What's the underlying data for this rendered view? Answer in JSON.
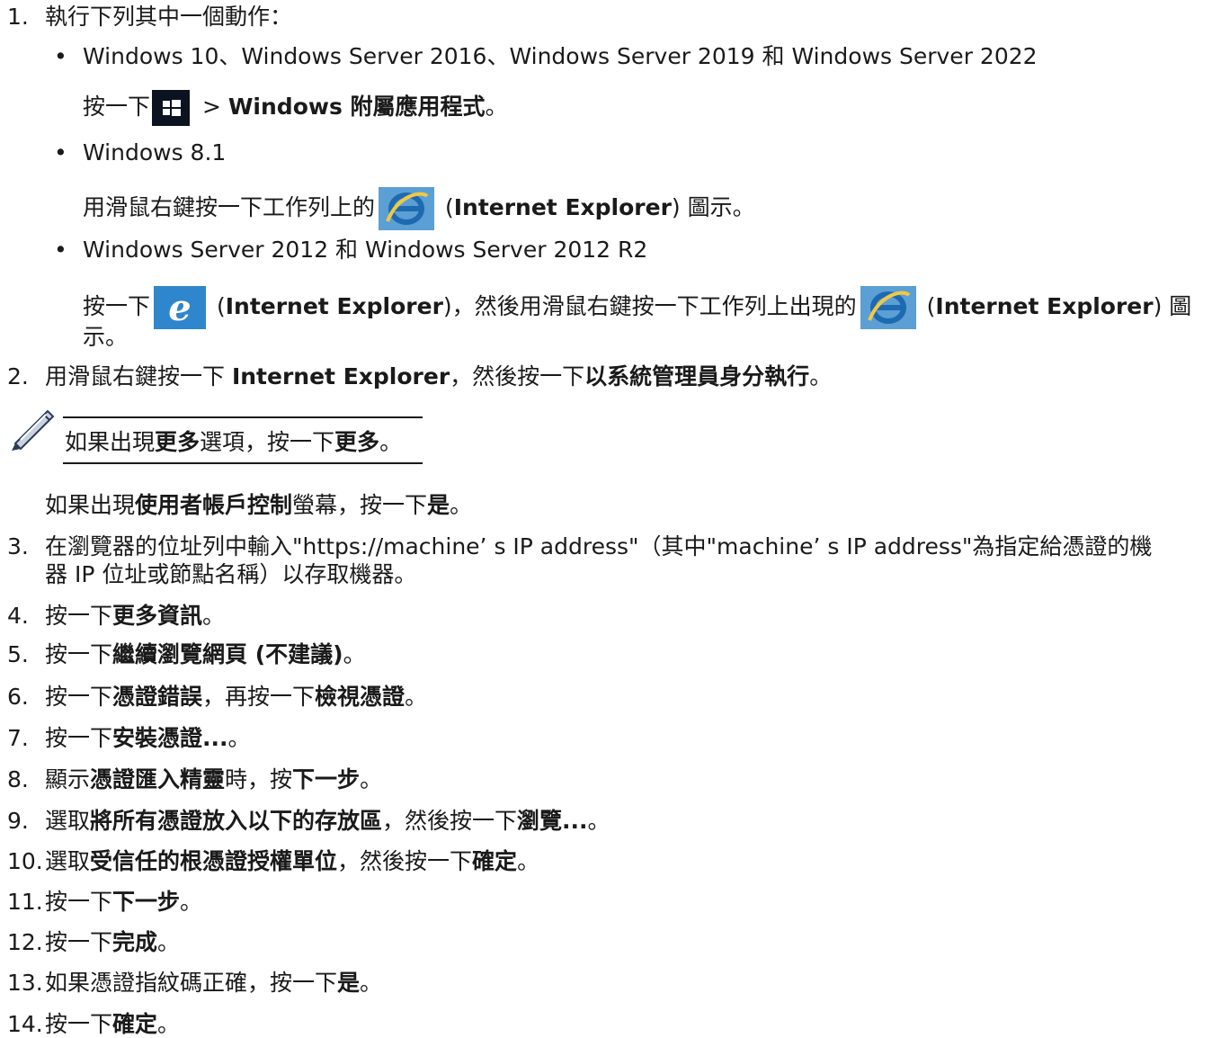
{
  "steps": {
    "s1": {
      "num": "1.",
      "text": "執行下列其中一個動作："
    },
    "s1_b1": {
      "title": "Windows 10、Windows Server 2016、Windows Server 2019 和 Windows Server 2022",
      "pre": "按一下",
      "gt": " > ",
      "bold": "Windows 附屬應用程式",
      "end": "。"
    },
    "s1_b2": {
      "title": "Windows 8.1",
      "pre": "用滑鼠右鍵按一下工作列上的",
      "paren_open": " (",
      "bold": "Internet Explorer",
      "paren_close": ") 圖示。"
    },
    "s1_b3": {
      "title": "Windows Server 2012 和 Windows Server 2012 R2",
      "pre": "按一下",
      "paren_open": " (",
      "bold1": "Internet Explorer",
      "mid": ")，然後用滑鼠右鍵按一下工作列上出現的",
      "paren_open2": " (",
      "bold2": "Internet Explorer",
      "end1": ") 圖",
      "end2": "示。"
    },
    "s2": {
      "num": "2.",
      "pre": "用滑鼠右鍵按一下 ",
      "bold1": "Internet Explorer",
      "mid": "，然後按一下",
      "bold2": "以系統管理員身分執行",
      "end": "。"
    },
    "note": {
      "pre": "如果出現",
      "bold1": "更多",
      "mid": "選項，按一下",
      "bold2": "更多",
      "end": "。"
    },
    "uac": {
      "pre": "如果出現",
      "bold1": "使用者帳戶控制",
      "mid": "螢幕，按一下",
      "bold2": "是",
      "end": "。"
    },
    "s3": {
      "num": "3.",
      "line1": "在瀏覽器的位址列中輸入\"https://machine’ s IP address\"（其中\"machine’ s IP address\"為指定給憑證的機",
      "line2": "器 IP 位址或節點名稱）以存取機器。"
    },
    "s4": {
      "num": "4.",
      "pre": "按一下",
      "bold": "更多資訊",
      "end": "。"
    },
    "s5": {
      "num": "5.",
      "pre": "按一下",
      "bold": "繼續瀏覽網頁 (不建議)",
      "end": "。"
    },
    "s6": {
      "num": "6.",
      "pre": "按一下",
      "bold1": "憑證錯誤",
      "mid": "，再按一下",
      "bold2": "檢視憑證",
      "end": "。"
    },
    "s7": {
      "num": "7.",
      "pre": "按一下",
      "bold": "安裝憑證...",
      "end": "。"
    },
    "s8": {
      "num": "8.",
      "pre": "顯示",
      "bold1": "憑證匯入精靈",
      "mid": "時，按",
      "bold2": "下一步",
      "end": "。"
    },
    "s9": {
      "num": "9.",
      "pre": "選取",
      "bold1": "將所有憑證放入以下的存放區",
      "mid": "，然後按一下",
      "bold2": "瀏覽...",
      "end": "。"
    },
    "s10": {
      "num": "10.",
      "pre": "選取",
      "bold1": "受信任的根憑證授權單位",
      "mid": "，然後按一下",
      "bold2": "確定",
      "end": "。"
    },
    "s11": {
      "num": "11.",
      "pre": "按一下",
      "bold": "下一步",
      "end": "。"
    },
    "s12": {
      "num": "12.",
      "pre": "按一下",
      "bold": "完成",
      "end": "。"
    },
    "s13": {
      "num": "13.",
      "pre": "如果憑證指紋碼正確，按一下",
      "bold": "是",
      "end": "。"
    },
    "s14": {
      "num": "14.",
      "pre": "按一下",
      "bold": "確定",
      "end": "。"
    }
  },
  "bullet_char": "•",
  "icons": {
    "windows": "windows-start-icon",
    "ie_taskbar": "internet-explorer-taskbar-icon",
    "ie_tile": "internet-explorer-tile-icon",
    "note": "pencil-note-icon"
  },
  "colors": {
    "text": "#1a1a1a",
    "win_tile": "#0b1220",
    "ie_blue": "#3a8fd0"
  }
}
